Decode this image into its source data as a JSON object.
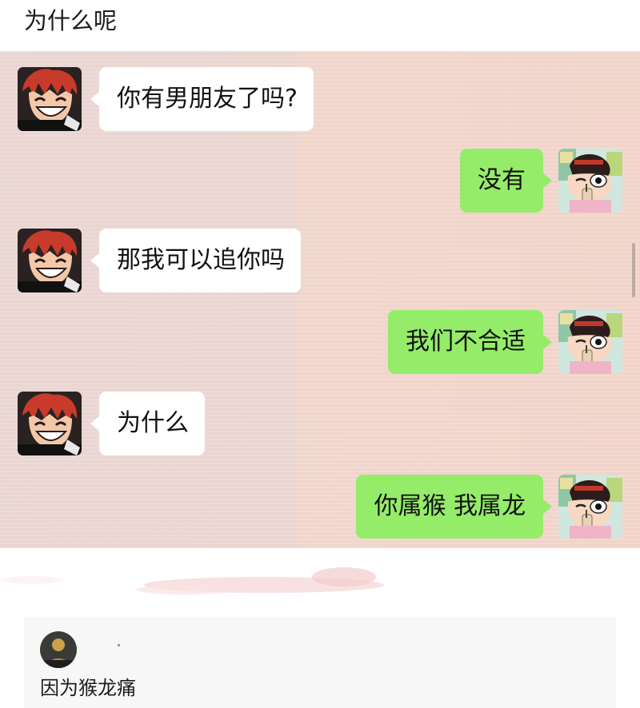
{
  "post": {
    "title": "为什么呢"
  },
  "chat": {
    "messages": [
      {
        "side": "left",
        "text": "你有男朋友了吗?"
      },
      {
        "side": "right",
        "text": "没有"
      },
      {
        "side": "left",
        "text": "那我可以追你吗"
      },
      {
        "side": "right",
        "text": "我们不合适"
      },
      {
        "side": "left",
        "text": "为什么"
      },
      {
        "side": "right",
        "text": "你属猴 我属龙"
      }
    ],
    "colors": {
      "sent_bubble": "#95ec69",
      "received_bubble": "#ffffff"
    }
  },
  "comment": {
    "text": "因为猴龙痛"
  },
  "icons": {
    "left_avatar": "anime-red-hair-avatar-icon",
    "right_avatar": "crayon-shinchan-avatar-icon",
    "commenter_avatar": "commenter-avatar-icon"
  }
}
